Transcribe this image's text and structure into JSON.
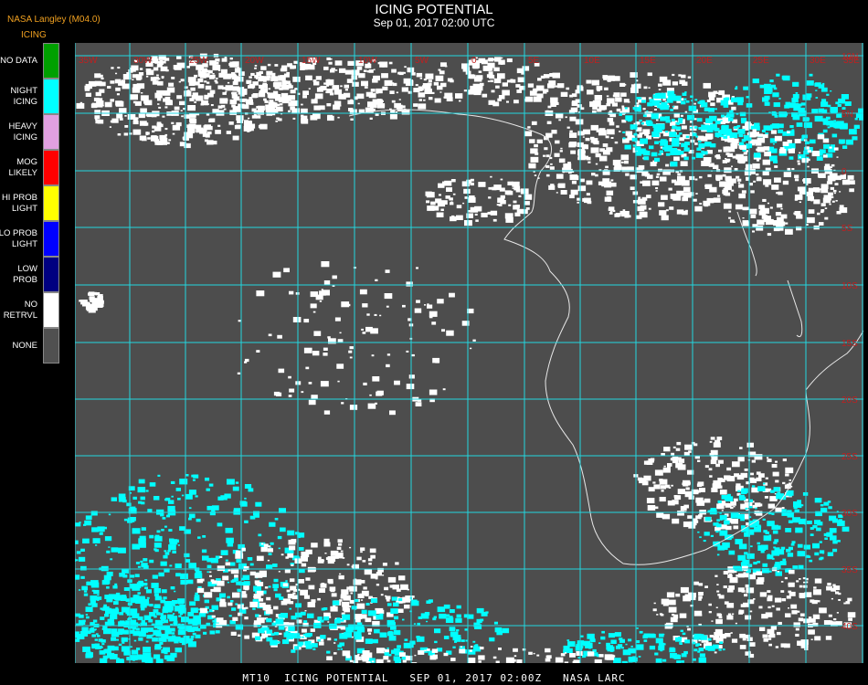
{
  "header": {
    "producer": "NASA Langley (M04.0)",
    "product": "ICING",
    "title": "ICING POTENTIAL",
    "datetime": "Sep 01, 2017 02:00 UTC"
  },
  "legend": {
    "items": [
      {
        "label": "NO DATA",
        "color": "#00a000"
      },
      {
        "label": "NIGHT\nICING",
        "color": "#00ffff"
      },
      {
        "label": "HEAVY\nICING",
        "color": "#e0a0e0"
      },
      {
        "label": "MOG\nLIKELY",
        "color": "#ff0000"
      },
      {
        "label": "HI PROB\nLIGHT",
        "color": "#ffff00"
      },
      {
        "label": "LO PROB\nLIGHT",
        "color": "#0000ff"
      },
      {
        "label": "LOW\nPROB",
        "color": "#000080"
      },
      {
        "label": "NO\nRETRVL",
        "color": "#ffffff"
      },
      {
        "label": "NONE",
        "color": "#505050"
      }
    ]
  },
  "map": {
    "background_color": "#4d4d4d",
    "grid_color": "#22d6e0",
    "grid_label_color": "#c02020",
    "top_labels": [
      "35W",
      "30W",
      "25W",
      "20W",
      "15W",
      "10W",
      "5W",
      "0",
      "5E",
      "10E",
      "15E",
      "20E",
      "25E",
      "30E",
      "35E"
    ],
    "right_labels": [
      "10N",
      "5N",
      "0",
      "5S",
      "10S",
      "15S",
      "20S",
      "25S",
      "30S",
      "35S",
      "40S"
    ]
  },
  "footer": {
    "text": "MT10  ICING POTENTIAL   SEP 01, 2017 02:00Z   NASA LARC"
  }
}
